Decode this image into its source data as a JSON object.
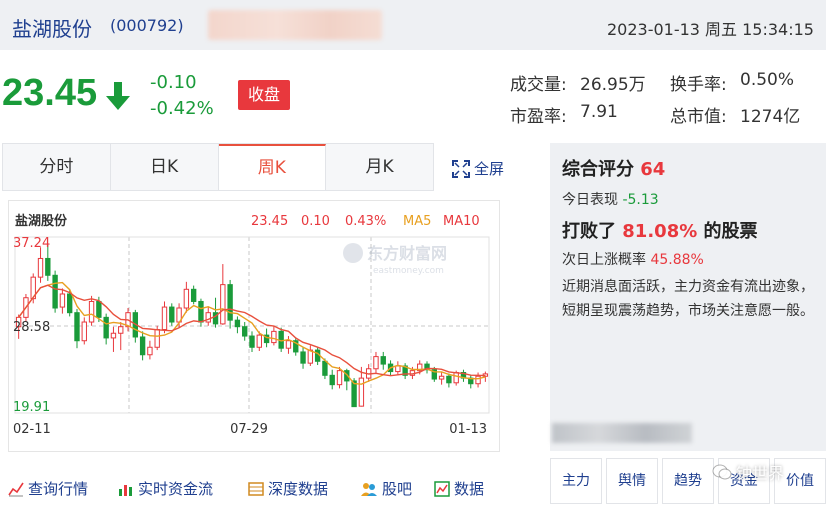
{
  "header": {
    "stock_name": "盐湖股份",
    "stock_code": "(000792)",
    "datetime": "2023-01-13 周五 15:34:15"
  },
  "quote": {
    "price": "23.45",
    "change": "-0.10",
    "change_pct": "-0.42%",
    "status_badge": "收盘",
    "volume_label": "成交量:",
    "volume_value": "26.95万",
    "turnover_label": "换手率:",
    "turnover_value": "0.50%",
    "pe_label": "市盈率:",
    "pe_value": "7.91",
    "mktcap_label": "总市值:",
    "mktcap_value": "1274亿",
    "up_color": "#e8383d",
    "down_color": "#1a9b3a"
  },
  "tabs": [
    {
      "label": "分时",
      "active": false
    },
    {
      "label": "日K",
      "active": false
    },
    {
      "label": "周K",
      "active": true
    },
    {
      "label": "月K",
      "active": false
    }
  ],
  "fullscreen_label": "全屏",
  "chart_data": {
    "type": "candlestick",
    "title": "盐湖股份",
    "legend_values": {
      "price": "23.45",
      "change": "0.10",
      "change_pct": "0.43%",
      "ma5": "MA5",
      "ma10": "MA10"
    },
    "ylim": [
      19.91,
      37.24
    ],
    "y_ticks": [
      "37.24",
      "28.58",
      "19.91"
    ],
    "x_ticks": [
      "02-11",
      "07-29",
      "01-13"
    ],
    "watermark": "东方财富网",
    "watermark_sub": "eastmoney.com",
    "candles": [
      [
        28.5,
        29.5,
        27.2,
        29.8
      ],
      [
        29.5,
        31.6,
        29.0,
        32.0
      ],
      [
        31.5,
        33.8,
        31.0,
        34.2
      ],
      [
        33.8,
        35.8,
        33.2,
        37.0
      ],
      [
        35.8,
        34.0,
        33.4,
        37.24
      ],
      [
        34.0,
        30.5,
        30.0,
        34.5
      ],
      [
        30.6,
        32.0,
        29.9,
        32.6
      ],
      [
        32.0,
        30.0,
        29.6,
        32.5
      ],
      [
        30.0,
        27.0,
        26.2,
        30.4
      ],
      [
        27.0,
        29.0,
        26.6,
        29.5
      ],
      [
        29.0,
        31.2,
        28.6,
        31.8
      ],
      [
        31.2,
        29.5,
        29.0,
        31.7
      ],
      [
        29.5,
        27.3,
        26.6,
        29.9
      ],
      [
        27.3,
        27.8,
        25.8,
        28.5
      ],
      [
        27.8,
        28.5,
        26.0,
        29.0
      ],
      [
        28.5,
        30.0,
        28.0,
        30.5
      ],
      [
        30.0,
        27.4,
        26.8,
        30.3
      ],
      [
        27.4,
        25.5,
        24.9,
        28.0
      ],
      [
        25.5,
        26.3,
        25.0,
        27.0
      ],
      [
        26.3,
        28.2,
        26.0,
        28.6
      ],
      [
        28.2,
        30.6,
        27.8,
        31.2
      ],
      [
        30.6,
        29.0,
        28.6,
        31.0
      ],
      [
        29.0,
        30.5,
        28.4,
        31.0
      ],
      [
        30.5,
        32.5,
        30.0,
        33.3
      ],
      [
        32.5,
        31.2,
        30.9,
        32.9
      ],
      [
        31.2,
        29.0,
        28.5,
        31.5
      ],
      [
        29.0,
        30.0,
        28.6,
        30.6
      ],
      [
        30.0,
        28.8,
        28.4,
        31.6
      ],
      [
        28.8,
        33.0,
        28.7,
        35.2
      ],
      [
        33.0,
        29.2,
        28.3,
        33.5
      ],
      [
        29.2,
        28.5,
        27.8,
        29.6
      ],
      [
        28.5,
        27.5,
        27.0,
        29.0
      ],
      [
        27.5,
        26.3,
        25.8,
        28.0
      ],
      [
        26.3,
        27.6,
        25.9,
        28.0
      ],
      [
        27.6,
        26.8,
        26.3,
        28.3
      ],
      [
        26.8,
        28.0,
        26.5,
        28.6
      ],
      [
        28.0,
        26.2,
        25.8,
        28.4
      ],
      [
        26.2,
        27.0,
        25.6,
        27.5
      ],
      [
        27.0,
        25.8,
        25.4,
        27.3
      ],
      [
        25.8,
        24.6,
        24.0,
        26.3
      ],
      [
        24.6,
        26.0,
        24.3,
        26.5
      ],
      [
        26.0,
        24.8,
        24.4,
        26.3
      ],
      [
        24.8,
        23.3,
        22.9,
        25.1
      ],
      [
        23.3,
        22.3,
        21.8,
        23.9
      ],
      [
        22.3,
        23.8,
        21.9,
        24.2
      ],
      [
        23.8,
        22.7,
        21.7,
        24.0
      ],
      [
        22.7,
        19.95,
        19.91,
        23.0
      ],
      [
        20.0,
        23.0,
        19.95,
        24.2
      ],
      [
        23.0,
        24.0,
        22.6,
        24.5
      ],
      [
        24.0,
        25.3,
        23.5,
        25.8
      ],
      [
        25.3,
        24.5,
        23.9,
        25.8
      ],
      [
        24.5,
        23.7,
        23.3,
        24.9
      ],
      [
        23.7,
        24.3,
        23.3,
        24.8
      ],
      [
        24.3,
        23.3,
        22.9,
        24.6
      ],
      [
        23.3,
        23.8,
        22.9,
        24.2
      ],
      [
        23.8,
        24.5,
        23.4,
        24.9
      ],
      [
        24.5,
        23.9,
        23.5,
        24.8
      ],
      [
        23.9,
        22.9,
        22.6,
        24.2
      ],
      [
        22.9,
        23.2,
        22.3,
        23.6
      ],
      [
        23.2,
        22.5,
        22.0,
        23.5
      ],
      [
        22.5,
        23.6,
        22.2,
        23.8
      ],
      [
        23.6,
        23.0,
        22.6,
        23.9
      ],
      [
        23.0,
        22.4,
        21.9,
        23.3
      ],
      [
        22.4,
        23.2,
        22.0,
        23.6
      ],
      [
        23.2,
        23.45,
        22.6,
        23.7
      ]
    ],
    "ma5_color": "#e8a020",
    "ma10_color": "#e8503d",
    "grid": true
  },
  "bottom_links": [
    {
      "label": "查询行情",
      "icon": "chart-line-icon"
    },
    {
      "label": "实时资金流",
      "icon": "bar-chart-icon"
    },
    {
      "label": "深度数据",
      "icon": "table-icon"
    },
    {
      "label": "股吧",
      "icon": "users-icon"
    },
    {
      "label": "数据",
      "icon": "data-icon"
    }
  ],
  "panel": {
    "title": "综合评分",
    "score": "64",
    "today_label": "今日表现",
    "today_value": "-5.13",
    "beat_prefix": "打败了",
    "beat_pct": "81.08%",
    "beat_suffix": "的股票",
    "prob_label": "次日上涨概率",
    "prob_value": "45.88%",
    "description": "近期消息面活跃，主力资金有流出迹象，短期呈现震荡趋势，市场关注意愿一般。"
  },
  "panel_buttons": [
    "主力",
    "舆情",
    "趋势",
    "资金",
    "价值"
  ],
  "watermark_text": "钟世界"
}
